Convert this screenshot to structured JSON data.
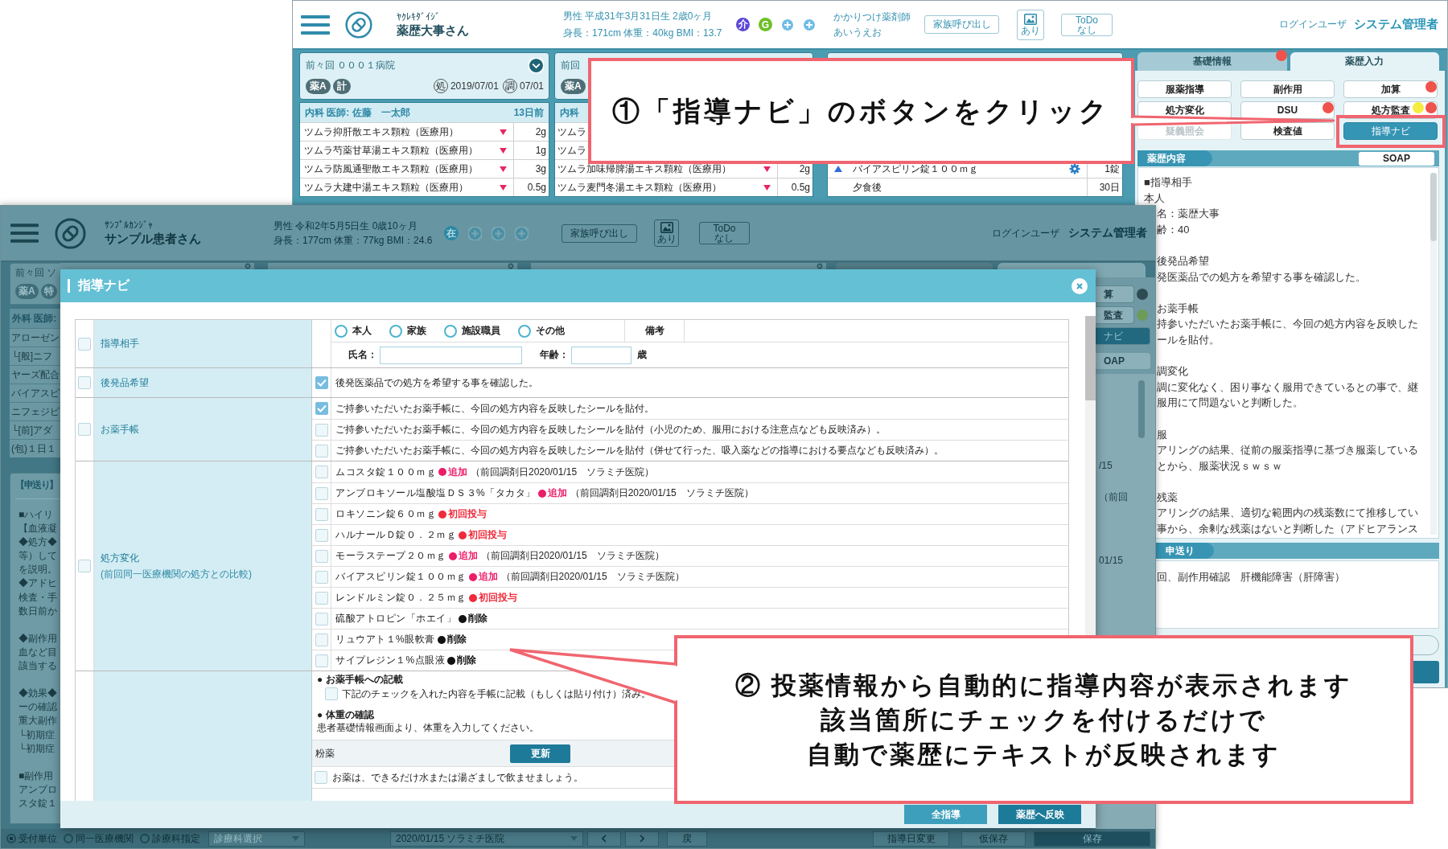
{
  "back_window": {
    "header": {
      "app_kana": "ﾔｸﾚｷﾀﾞｲｼﾞ",
      "patient_name": "薬歴大事さん",
      "patient_info": [
        "男性 平成31年3月31日生 2歳0ヶ月",
        "身長：171cm 体重：40kg BMI：13.7"
      ],
      "badges": [
        {
          "label": "介",
          "color": "#5b47d6"
        },
        {
          "label": "G",
          "color": "#6dbf26"
        }
      ],
      "pharmacist": [
        "かかりつけ薬剤師",
        "あいうえお"
      ],
      "family_button": "家族呼び出し",
      "image_button": "あり",
      "todo_button": [
        "ToDo",
        "なし"
      ],
      "login_label": "ログインユーザ",
      "login_user": "システム管理者"
    },
    "panels": [
      {
        "title": "前々回 ０００１病院",
        "tags": [
          "薬A",
          "計"
        ],
        "rx_mark": "処",
        "rx_date": "2019/07/01",
        "disp_mark": "調",
        "disp_date": "07/01",
        "doctor": "内科 医師: 佐藤　一太郎",
        "ago": "13日前",
        "rows": [
          {
            "kind": "drug",
            "name": "ツムラ抑肝散エキス顆粒（医療用）",
            "dose": "2g"
          },
          {
            "kind": "drug",
            "name": "ツムラ芍薬甘草湯エキス顆粒（医療用）",
            "dose": "1g"
          },
          {
            "kind": "drug",
            "name": "ツムラ防風通聖散エキス顆粒（医療用）",
            "dose": "3g"
          },
          {
            "kind": "drug",
            "name": "ツムラ大建中湯エキス顆粒（医療用）",
            "dose": "0.5g"
          }
        ]
      },
      {
        "title": "前回",
        "tags": [
          "薬A"
        ],
        "doctor": "内科",
        "rows": [
          {
            "kind": "drug",
            "name": "ツムラ"
          },
          {
            "kind": "drug",
            "name": "ツムラ"
          },
          {
            "kind": "drug",
            "name": "ツムラ加味帰脾湯エキス顆粒（医療用）",
            "dose": "2g"
          },
          {
            "kind": "drug",
            "name": "ツムラ麦門冬湯エキス顆粒（医療用）",
            "dose": "0.5g"
          }
        ]
      },
      {
        "rows": [
          {
            "kind": "current",
            "name": "バイアスピリン錠１００ｍｇ",
            "dose": "1錠",
            "flagged": true
          },
          {
            "kind": "usage",
            "name": "夕食後",
            "dose": "30日"
          }
        ]
      }
    ],
    "side": {
      "tabs": [
        {
          "label": "基礎情報",
          "selected": false,
          "dots": [
            {
              "color": "#f0524c"
            }
          ]
        },
        {
          "label": "薬歴入力",
          "selected": true
        }
      ],
      "buttons": [
        {
          "label": "服薬指導",
          "primary": false,
          "disabled": false
        },
        {
          "label": "副作用",
          "primary": false,
          "disabled": false
        },
        {
          "label": "加算",
          "primary": false,
          "disabled": false,
          "dots": [
            {
              "color": "#f0524c"
            }
          ]
        },
        {
          "label": "処方変化",
          "primary": false,
          "disabled": false
        },
        {
          "label": "DSU",
          "primary": false,
          "disabled": false,
          "dots": [
            {
              "color": "#f0524c"
            }
          ]
        },
        {
          "label": "処方監査",
          "primary": false,
          "disabled": false,
          "dots": [
            {
              "color": "#f5ec3f"
            },
            {
              "color": "#f0524c"
            }
          ]
        },
        {
          "label": "疑義照会",
          "primary": false,
          "disabled": true
        },
        {
          "label": "検査値",
          "primary": false,
          "disabled": false
        },
        {
          "label": "指導ナビ",
          "primary": true,
          "disabled": false
        }
      ],
      "record_title": "薬歴内容",
      "soap_button": "SOAP",
      "record_intro": [
        "■指導相手",
        "本人"
      ],
      "record_groups": [
        [
          "名：薬歴大事",
          "齢：40"
        ],
        [
          "後発品希望",
          "発医薬品での処方を希望する事を確認した。"
        ],
        [
          "お薬手帳",
          "持参いただいたお薬手帳に、今回の処方内容を反映した",
          "ールを貼付。"
        ],
        [
          "調変化",
          "調に変化なく、困り事なく服用できているとの事で、継",
          "服用にて問題ないと判断した。"
        ],
        [
          "服",
          "アリングの結果、従前の服薬指導に基づき服薬している",
          "とから、服薬状況ｓｗｓｗ"
        ],
        [
          "残薬",
          "アリングの結果、適切な範囲内の残薬数にて推移してい",
          "事から、余剰な残薬はないと判断した（アドヒアランス"
        ]
      ],
      "handover_title": "申送り",
      "handover_text": "回、副作用確認　肝機能障害（肝障害）"
    }
  },
  "front_window": {
    "header": {
      "app_kana": "ｻﾝﾌﾟﾙｶﾝｼﾞｬ",
      "patient_name": "サンプル患者さん",
      "patient_info": [
        "男性 令和2年5月5日生 0歳10ヶ月",
        "身長：177cm 体重：77kg BMI：24.6"
      ],
      "badges": [
        {
          "label": "在",
          "color": "#2b88a4"
        }
      ],
      "family_button": "家族呼び出し",
      "image_button": "あり",
      "todo_button": [
        "ToDo",
        "なし"
      ],
      "login_label": "ログインユーザ",
      "login_user": "システム管理者"
    },
    "left_panel": {
      "title": "前々回 ソ",
      "tags": [
        "薬A",
        "特"
      ],
      "doctor": "外科 医師:",
      "rows": [
        "アローゼン",
        "└[般]ニフ",
        "ヤーズ配合",
        "バイアスピ",
        "ニフェジピ",
        "└[前]アダ",
        "(包)１日１"
      ]
    },
    "handover": {
      "title": "【申送り】",
      "groups": [
        [
          "■ハイリ",
          "【血液凝",
          "◆処方◆",
          "等）して",
          "を説明。",
          "◆アドヒ",
          "検査・手",
          "数日前か"
        ],
        [
          "◆副作用",
          "血など目",
          "該当する"
        ],
        [
          "◆効果◆",
          "ーの確認",
          "重大副作",
          "└初期症",
          "└初期症"
        ],
        [
          "■副作用",
          "アンプロ",
          "スタ錠１"
        ]
      ]
    },
    "right_strip": {
      "buttons": [
        {
          "label": "算",
          "primary": false,
          "dots": [
            {
              "color": "#2e4b53"
            }
          ]
        },
        {
          "label": "監査",
          "primary": false,
          "dots": [
            {
              "color": "#6e9b59"
            }
          ]
        },
        {
          "label": "ナビ",
          "primary": true
        }
      ],
      "soap_button": "OAP",
      "lines": [
        "/15",
        "（前回",
        "01/15"
      ]
    },
    "bottom_bar": {
      "units": [
        {
          "label": "受付単位",
          "selected": true
        },
        {
          "label": "同一医療機関",
          "selected": false
        },
        {
          "label": "診療科指定",
          "selected": false
        }
      ],
      "department_select": "診療科選択",
      "visit_select": "2020/01/15 ソラミチ医院",
      "back_button": "戻",
      "date_button": "指導日変更",
      "draft_button": "仮保存",
      "save_button": "保存"
    }
  },
  "dialog": {
    "title": "指導ナビ",
    "sections": [
      {
        "kind": "target",
        "label": "指導相手",
        "checked": false,
        "options": [
          {
            "label": "本人",
            "selected": false
          },
          {
            "label": "家族",
            "selected": false
          },
          {
            "label": "施設職員",
            "selected": false
          },
          {
            "label": "その他",
            "selected": false
          }
        ],
        "remarks_header": "備考",
        "name_label": "氏名：",
        "age_label": "年齢：",
        "age_unit": "歳"
      },
      {
        "kind": "options",
        "label": "後発品希望",
        "checked": false,
        "items": [
          {
            "text": "後発医薬品での処方を希望する事を確認した。",
            "checked": true
          }
        ]
      },
      {
        "kind": "options",
        "label": "お薬手帳",
        "checked": false,
        "items": [
          {
            "text": "ご持参いただいたお薬手帳に、今回の処方内容を反映したシールを貼付。",
            "checked": true
          },
          {
            "text": "ご持参いただいたお薬手帳に、今回の処方内容を反映したシールを貼付（小児のため、服用における注意点なども反映済み）。",
            "checked": false
          },
          {
            "text": "ご持参いただいたお薬手帳に、今回の処方内容を反映したシールを貼付（併せて行った、吸入薬などの指導における要点なども反映済み）。",
            "checked": false
          }
        ]
      },
      {
        "kind": "changes",
        "label": "処方変化",
        "sublabel": "(前回同一医療機関の処方との比較)",
        "checked": false,
        "items": [
          {
            "drug": "ムコスタ錠１００ｍｇ",
            "status": "追加",
            "color": "#ec1c68",
            "note": "（前回調剤日2020/01/15　ソラミチ医院）",
            "checked": false
          },
          {
            "drug": "アンブロキソール塩酸塩ＤＳ３%「タカタ」",
            "status": "追加",
            "color": "#ec1c68",
            "note": "（前回調剤日2020/01/15　ソラミチ医院）",
            "checked": false
          },
          {
            "drug": "ロキソニン錠６０ｍｇ",
            "status": "初回投与",
            "color": "#f02b3c",
            "checked": false
          },
          {
            "drug": "ハルナールＤ錠０．２ｍｇ",
            "status": "初回投与",
            "color": "#f02b3c",
            "checked": false
          },
          {
            "drug": "モーラステープ２０ｍｇ",
            "status": "追加",
            "color": "#ec1c68",
            "note": "（前回調剤日2020/01/15　ソラミチ医院）",
            "checked": false
          },
          {
            "drug": "バイアスピリン錠１００ｍｇ",
            "status": "追加",
            "color": "#ec1c68",
            "note": "（前回調剤日2020/01/15　ソラミチ医院）",
            "checked": false
          },
          {
            "drug": "レンドルミン錠０．２５ｍｇ",
            "status": "初回投与",
            "color": "#f02b3c",
            "checked": false
          },
          {
            "drug": "硫酸アトロピン「ホエイ」",
            "status": "削除",
            "color": "#111111",
            "checked": false
          },
          {
            "drug": "リュウアト１%眼軟膏",
            "status": "削除",
            "color": "#111111",
            "checked": false
          },
          {
            "drug": "サイプレジン１%点眼液",
            "status": "削除",
            "color": "#111111",
            "checked": false
          }
        ]
      },
      {
        "kind": "notes",
        "blocks": [
          {
            "heading": "● お薬手帳への記載",
            "check_text": "下記のチェックを入れた内容を手帳に記載（もしくは貼り付け）済み。",
            "checked": false
          },
          {
            "heading": "● 体重の確認",
            "text": "患者基礎情報画面より、体重を入力してください。"
          }
        ],
        "group_title": "粉薬",
        "update_button": "更新",
        "items": [
          {
            "text": "お薬は、できるだけ水または湯ざましで飲ませましょう。",
            "checked": false
          }
        ]
      }
    ],
    "footer_buttons": [
      "全指導",
      "薬歴へ反映"
    ]
  },
  "callouts": [
    {
      "lines": [
        "①「指導ナビ」のボタンをクリック"
      ]
    },
    {
      "lines": [
        "② 投薬情報から自動的に指導内容が表示されます",
        "該当箇所にチェックを付けるだけで",
        "自動で薬歴にテキストが反映されます"
      ]
    }
  ]
}
